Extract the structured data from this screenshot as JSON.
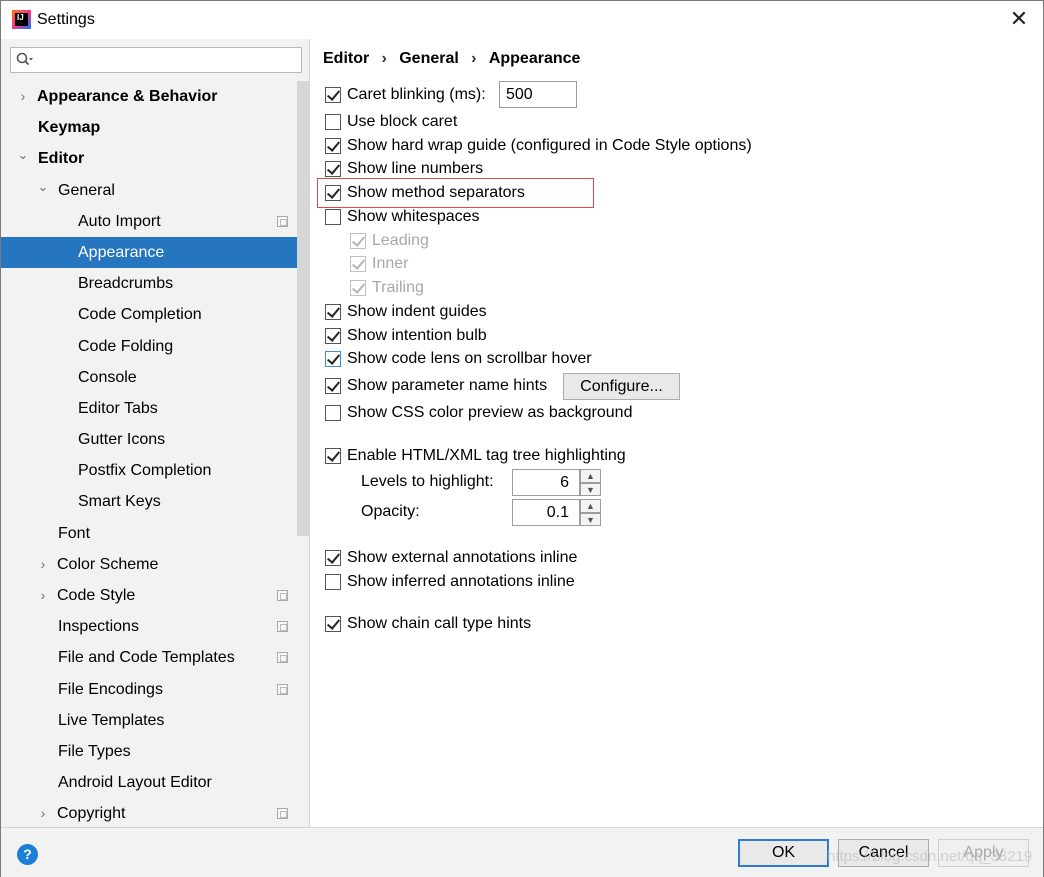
{
  "window": {
    "title": "Settings",
    "close_glyph": "✕"
  },
  "search": {
    "placeholder": "",
    "icon": "search-icon"
  },
  "tree": [
    {
      "label": "Appearance & Behavior",
      "bold": true,
      "arrow": "›",
      "expandable": true,
      "expanded": false,
      "icon": false
    },
    {
      "label": "Keymap",
      "bold": true,
      "arrow": "",
      "icon": false
    },
    {
      "label": "Editor",
      "bold": true,
      "arrow": "⌄",
      "expandable": true,
      "expanded": true,
      "icon": false
    },
    {
      "label": "General",
      "bold": false,
      "arrow": "⌄",
      "expandable": true,
      "expanded": true,
      "icon": false
    },
    {
      "label": "Auto Import",
      "bold": false,
      "arrow": "",
      "icon": true
    },
    {
      "label": "Appearance",
      "bold": false,
      "arrow": "",
      "icon": false,
      "selected": true
    },
    {
      "label": "Breadcrumbs",
      "bold": false,
      "arrow": "",
      "icon": false
    },
    {
      "label": "Code Completion",
      "bold": false,
      "arrow": "",
      "icon": false
    },
    {
      "label": "Code Folding",
      "bold": false,
      "arrow": "",
      "icon": false
    },
    {
      "label": "Console",
      "bold": false,
      "arrow": "",
      "icon": false
    },
    {
      "label": "Editor Tabs",
      "bold": false,
      "arrow": "",
      "icon": false
    },
    {
      "label": "Gutter Icons",
      "bold": false,
      "arrow": "",
      "icon": false
    },
    {
      "label": "Postfix Completion",
      "bold": false,
      "arrow": "",
      "icon": false
    },
    {
      "label": "Smart Keys",
      "bold": false,
      "arrow": "",
      "icon": false
    },
    {
      "label": "Font",
      "bold": false,
      "arrow": "",
      "icon": false
    },
    {
      "label": "Color Scheme",
      "bold": false,
      "arrow": "›",
      "expandable": true,
      "icon": false
    },
    {
      "label": "Code Style",
      "bold": false,
      "arrow": "›",
      "expandable": true,
      "icon": true
    },
    {
      "label": "Inspections",
      "bold": false,
      "arrow": "",
      "icon": true
    },
    {
      "label": "File and Code Templates",
      "bold": false,
      "arrow": "",
      "icon": true
    },
    {
      "label": "File Encodings",
      "bold": false,
      "arrow": "",
      "icon": true
    },
    {
      "label": "Live Templates",
      "bold": false,
      "arrow": "",
      "icon": false
    },
    {
      "label": "File Types",
      "bold": false,
      "arrow": "",
      "icon": false
    },
    {
      "label": "Android Layout Editor",
      "bold": false,
      "arrow": "",
      "icon": false
    },
    {
      "label": "Copyright",
      "bold": false,
      "arrow": "›",
      "expandable": true,
      "icon": true
    }
  ],
  "breadcrumb": {
    "items": [
      "Editor",
      "General",
      "Appearance"
    ],
    "separator": "›"
  },
  "options": {
    "caret_blinking": {
      "label": "Caret blinking (ms):",
      "checked": true,
      "value": "500"
    },
    "block_caret": {
      "label": "Use block caret",
      "checked": false
    },
    "hard_wrap": {
      "label": "Show hard wrap guide (configured in Code Style options)",
      "checked": true
    },
    "line_numbers": {
      "label": "Show line numbers",
      "checked": true
    },
    "method_separators": {
      "label": "Show method separators",
      "checked": true
    },
    "whitespaces": {
      "label": "Show whitespaces",
      "checked": false
    },
    "leading": {
      "label": "Leading",
      "checked": true,
      "disabled": true
    },
    "inner": {
      "label": "Inner",
      "checked": true,
      "disabled": true
    },
    "trailing": {
      "label": "Trailing",
      "checked": true,
      "disabled": true
    },
    "indent_guides": {
      "label": "Show indent guides",
      "checked": true
    },
    "intention_bulb": {
      "label": "Show intention bulb",
      "checked": true
    },
    "code_lens": {
      "label": "Show code lens on scrollbar hover",
      "checked": true
    },
    "param_hints": {
      "label": "Show parameter name hints",
      "checked": true,
      "button": "Configure..."
    },
    "css_color": {
      "label": "Show CSS color preview as background",
      "checked": false
    },
    "tag_tree": {
      "label": "Enable HTML/XML tag tree highlighting",
      "checked": true
    },
    "levels": {
      "label": "Levels to highlight:",
      "value": "6"
    },
    "opacity": {
      "label": "Opacity:",
      "value": "0.1"
    },
    "external_annotations": {
      "label": "Show external annotations inline",
      "checked": true
    },
    "inferred_annotations": {
      "label": "Show inferred annotations inline",
      "checked": false
    },
    "chain_call": {
      "label": "Show chain call type hints",
      "checked": true
    }
  },
  "footer": {
    "help": "?",
    "ok": "OK",
    "cancel": "Cancel",
    "apply": "Apply",
    "watermark": "https://blog.csdn.net/qq_38219"
  },
  "colors": {
    "selection": "#2675bf",
    "highlight_box": "#e04848",
    "sidebar_bg": "#f2f2f2"
  }
}
